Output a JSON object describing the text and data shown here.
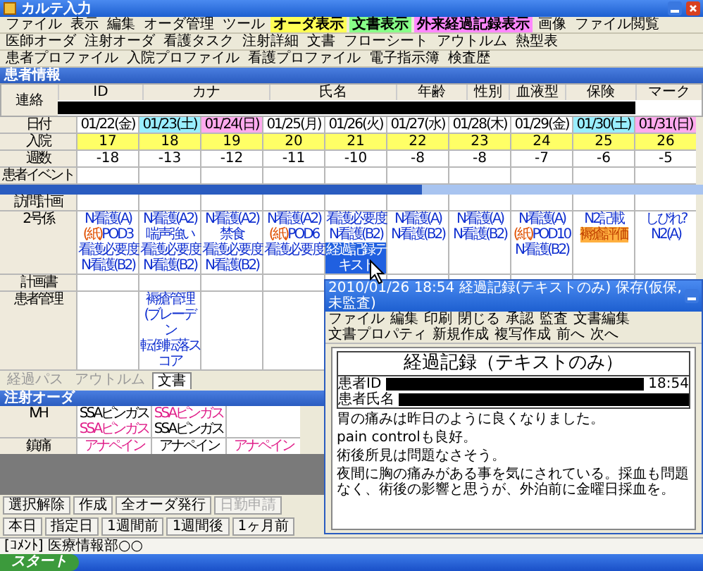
{
  "window": {
    "title": "カルテ入力"
  },
  "menu_rows": [
    [
      {
        "label": "ファイル"
      },
      {
        "label": "表示"
      },
      {
        "label": "編集"
      },
      {
        "label": "オーダ管理"
      },
      {
        "label": "ツール"
      },
      {
        "label": "オーダ表示",
        "color": "#ffff55"
      },
      {
        "label": "文書表示",
        "color": "#88ff88"
      },
      {
        "label": "外来経過記録表示",
        "color": "#ff88ff"
      },
      {
        "label": "画像"
      },
      {
        "label": "ファイル閲覧"
      }
    ],
    [
      {
        "label": "医師オーダ"
      },
      {
        "label": "注射オーダ"
      },
      {
        "label": "看護タスク"
      },
      {
        "label": "注射詳細"
      },
      {
        "label": "文書"
      },
      {
        "label": "フローシート"
      },
      {
        "label": "アウトルム"
      },
      {
        "label": "熱型表"
      }
    ],
    [
      {
        "label": "患者プロファイル"
      },
      {
        "label": "入院プロファイル"
      },
      {
        "label": "看護プロファイル"
      },
      {
        "label": "電子指示簿"
      },
      {
        "label": "検査歴"
      }
    ]
  ],
  "patient_info": {
    "title": "患者情報",
    "row_label": "連絡",
    "columns": [
      "ID",
      "カナ",
      "氏名",
      "年齢",
      "性別",
      "血液型",
      "保険",
      "マーク"
    ]
  },
  "schedule": {
    "header_label": "日付",
    "dates": [
      {
        "label": "01/22(金)",
        "color": "#ffffff"
      },
      {
        "label": "01/23(土)",
        "color": "#99eeff"
      },
      {
        "label": "01/24(日)",
        "color": "#ffaaee"
      },
      {
        "label": "01/25(月)",
        "color": "#ffffff"
      },
      {
        "label": "01/26(火)",
        "color": "#ffffff"
      },
      {
        "label": "01/27(水)",
        "color": "#ffffff"
      },
      {
        "label": "01/28(木)",
        "color": "#ffffff"
      },
      {
        "label": "01/29(金)",
        "color": "#ffffff"
      },
      {
        "label": "01/30(土)",
        "color": "#99eeff"
      },
      {
        "label": "01/31(日)",
        "color": "#ffaaee"
      }
    ],
    "rows": [
      {
        "label": "入院",
        "kind": "highlight",
        "values": [
          "17",
          "18",
          "19",
          "20",
          "21",
          "22",
          "23",
          "24",
          "25",
          "26"
        ]
      },
      {
        "label": "週数",
        "kind": "plain",
        "values": [
          "-18",
          "-13",
          "-12",
          "-11",
          "-10",
          "-8",
          "-8",
          "-7",
          "-6",
          "-5"
        ]
      },
      {
        "label": "患者イベント",
        "kind": "plain"
      }
    ]
  },
  "nursing": {
    "rows": [
      {
        "label": "訪問計画",
        "cells": []
      },
      {
        "label": "2号係",
        "cells": [
          [
            {
              "text": "N看護(A)",
              "kind": "link",
              "selected": false
            },
            {
              "tag": "(紙)",
              "text": "POD3",
              "kind": "link",
              "selected": false
            },
            {
              "text": "看護必要度",
              "kind": "link",
              "selected": false
            },
            {
              "text": "N看護(B2)",
              "kind": "link",
              "selected": false
            }
          ],
          [
            {
              "text": "N看護(A2)",
              "kind": "link",
              "selected": false
            },
            {
              "text": "喘声強い",
              "kind": "link",
              "selected": false
            },
            {
              "text": "看護必要度",
              "kind": "link",
              "selected": false
            },
            {
              "text": "N看護(B2)",
              "kind": "link",
              "selected": false
            }
          ],
          [
            {
              "text": "N看護(A2)",
              "kind": "link",
              "selected": false
            },
            {
              "text": "禁食",
              "kind": "link",
              "selected": false
            },
            {
              "text": "看護必要度",
              "kind": "link",
              "selected": false
            },
            {
              "text": "N看護(B2)",
              "kind": "link",
              "selected": false
            }
          ],
          [
            {
              "text": "N看護(A2)",
              "kind": "link",
              "selected": false
            },
            {
              "tag": "(紙)",
              "text": "POD6",
              "kind": "link",
              "selected": false
            },
            {
              "text": "看護必要度",
              "kind": "link",
              "selected": false
            }
          ],
          [
            {
              "text": "看護必要度",
              "kind": "link",
              "selected": false
            },
            {
              "text": "N看護(B2)",
              "kind": "link",
              "selected": false
            },
            {
              "text": "経過記録テキスト",
              "kind": "link",
              "selected": true
            }
          ],
          [
            {
              "text": "N看護(A)",
              "kind": "link",
              "selected": false
            },
            {
              "text": "N看護(B2)",
              "kind": "link",
              "selected": false
            }
          ],
          [
            {
              "text": "N看護(A)",
              "kind": "link",
              "selected": false
            },
            {
              "text": "N看護(B2)",
              "kind": "link",
              "selected": false
            }
          ],
          [
            {
              "text": "N看護(A)",
              "kind": "link",
              "selected": false
            },
            {
              "tag": "(紙)",
              "text": "POD10",
              "kind": "link",
              "selected": false
            },
            {
              "text": "N看護(B2)",
              "kind": "link",
              "selected": false
            }
          ],
          [
            {
              "text": "N2記載",
              "kind": "link",
              "selected": false
            },
            {
              "text": "褥瘡評価",
              "kind": "alert",
              "selected": false
            }
          ],
          [
            {
              "text": "しびれ?",
              "kind": "link",
              "selected": false
            },
            {
              "text": "N2(A)",
              "kind": "link",
              "selected": false
            }
          ]
        ]
      },
      {
        "label": "計画書",
        "cells": []
      },
      {
        "label": "患者管理",
        "cells": [
          [],
          [
            {
              "text": "褥瘡管理(ブレーデン",
              "kind": "link",
              "selected": false
            },
            {
              "text": "転倒転落スコア",
              "kind": "link",
              "selected": false
            }
          ]
        ]
      }
    ]
  },
  "tabs": [
    {
      "label": "経過パス",
      "selected": false
    },
    {
      "label": "アウトルム",
      "selected": false
    },
    {
      "label": "文書",
      "selected": true
    }
  ],
  "injection": {
    "title": "注射オーダ",
    "rows": [
      {
        "label": "IVH",
        "cells": [
          [
            {
              "text": "SSAピンガス",
              "color": "#000000"
            },
            {
              "text": "SSAピンガス",
              "color": "#e0208a"
            }
          ],
          [
            {
              "text": "SSAピンガス",
              "color": "#e0208a"
            },
            {
              "text": "SSAピンガス",
              "color": "#000000"
            }
          ]
        ]
      },
      {
        "label": "鎮痛",
        "cells": [
          [
            {
              "text": "アナペイン",
              "color": "#e0208a"
            }
          ],
          [
            {
              "text": "アナペイン",
              "color": "#000000"
            }
          ],
          [
            {
              "text": "アナペイン",
              "color": "#e0208a"
            }
          ]
        ]
      }
    ]
  },
  "action_bar": [
    {
      "label": "選択解除",
      "disabled": false
    },
    {
      "label": "作成",
      "disabled": false
    },
    {
      "label": "全オーダ発行",
      "disabled": false
    },
    {
      "label": "日勤申請",
      "disabled": true
    }
  ],
  "date_bar": [
    "本日",
    "指定日",
    "1週間前",
    "1週間後",
    "1ヶ月前"
  ],
  "status_bar": "[ｺﾒﾝﾄ] 医療情報部○○",
  "document_window": {
    "title": "2010/01/26 18:54 経過記録(テキストのみ) 保存(仮保,未監査)",
    "menu": [
      "ファイル",
      "編集",
      "印刷",
      "閉じる",
      "承認",
      "監査",
      "文書編集",
      "文書プロパティ",
      "新規作成",
      "複写作成",
      "前へ",
      "次へ"
    ],
    "heading": "経過記録（テキストのみ）",
    "fields": [
      {
        "label": "患者ID",
        "value": "18:54"
      },
      {
        "label": "患者氏名"
      }
    ],
    "body": [
      "胃の痛みは昨日のように良くなりました。",
      "pain controlも良好。",
      "術後所見は問題なさそう。",
      "夜間に胸の痛みがある事を気にされている。採血も問題なく、術後の影響と思うが、外泊前に金曜日採血を。"
    ]
  },
  "taskbar": {
    "start": "スタート"
  }
}
